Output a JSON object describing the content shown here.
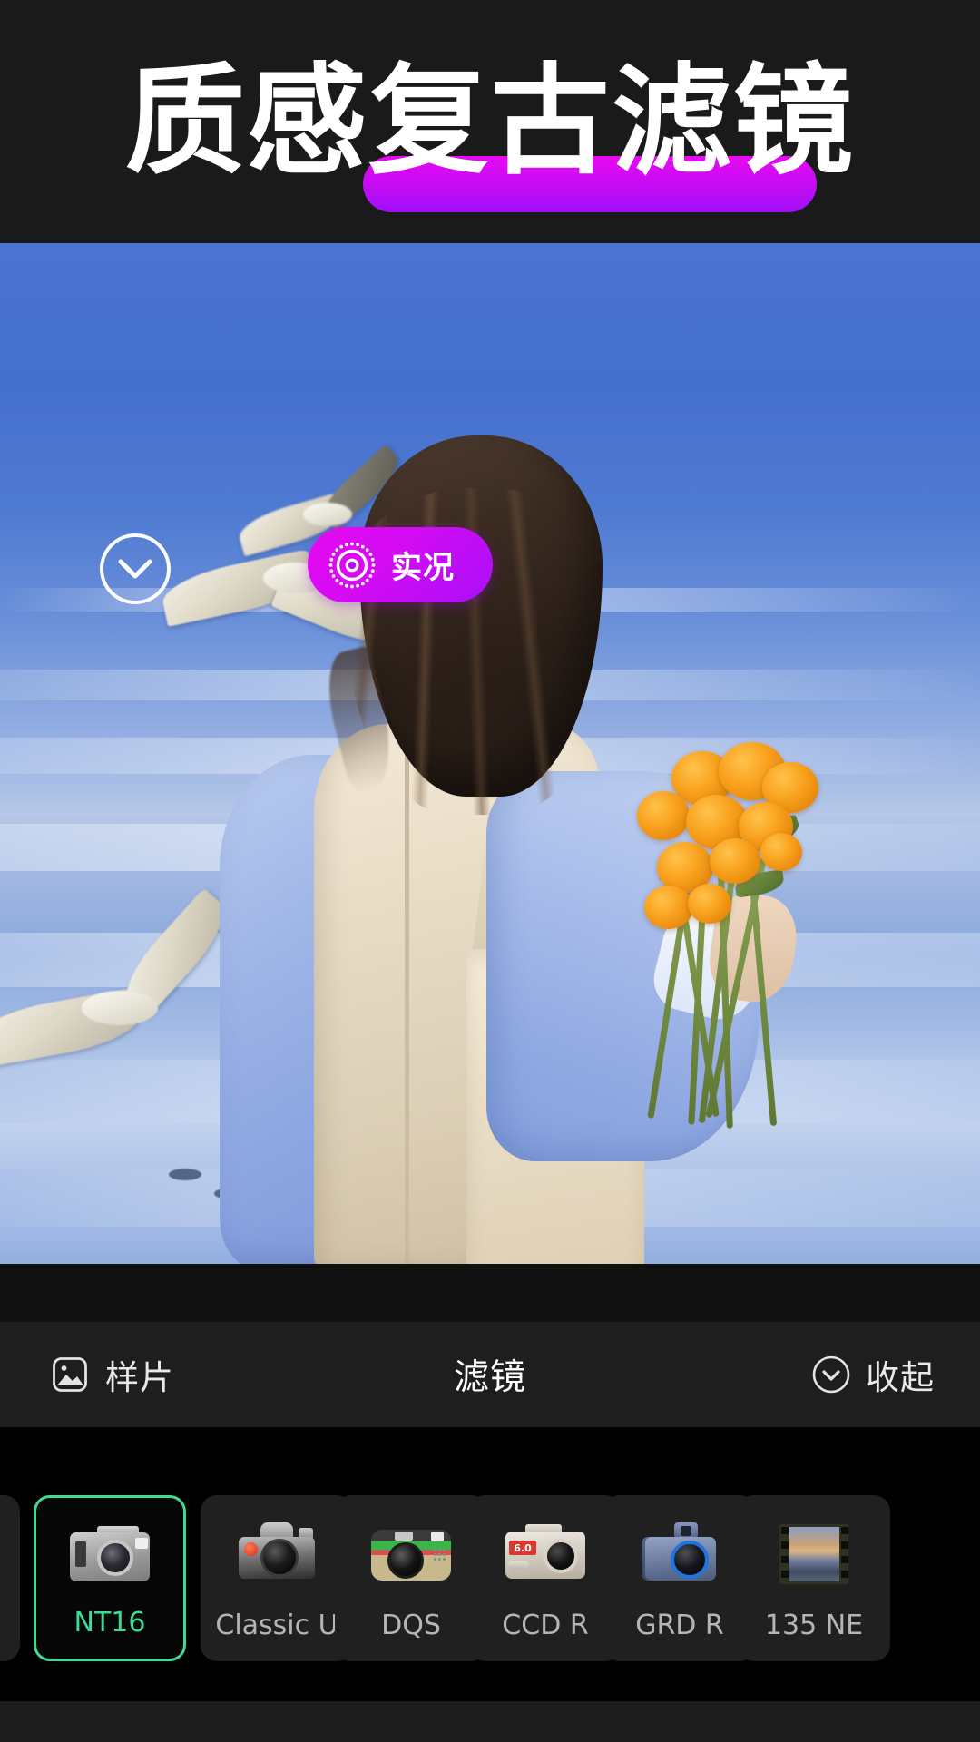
{
  "header": {
    "title": "质感复古滤镜",
    "highlight_color": "#d40bf3",
    "background_color": "#1a1a1a",
    "text_color": "#ffffff"
  },
  "photo_controls": {
    "collapse_circle_icon": "chevron-down-icon",
    "live_button": {
      "label": "实况",
      "icon": "live-photo-icon",
      "gradient_from": "#e609ef",
      "gradient_to": "#a910fa"
    }
  },
  "toolbar": {
    "sample_label": "样片",
    "sample_icon": "image-icon",
    "title": "滤镜",
    "collapse_label": "收起",
    "collapse_icon": "chevron-down-circle-icon",
    "background_color": "#1e1e1e"
  },
  "filters": {
    "selected_index": 1,
    "selected_color": "#3fdb96",
    "items": [
      {
        "label": "",
        "thumb": "camera-partial",
        "selected": false,
        "partial": true
      },
      {
        "label": "NT16",
        "thumb": "camera-compact-grey",
        "selected": true
      },
      {
        "label": "Classic U",
        "thumb": "camera-slr-silver",
        "selected": false
      },
      {
        "label": "DQS",
        "thumb": "camera-disposable-green",
        "selected": false
      },
      {
        "label": "CCD R",
        "thumb": "camera-compact-silver-6.0",
        "selected": false
      },
      {
        "label": "GRD R",
        "thumb": "camera-compact-blue",
        "selected": false
      },
      {
        "label": "135 NE",
        "thumb": "film-strip-sunset",
        "selected": false
      }
    ]
  },
  "photo": {
    "description": "woman-from-behind-with-orange-bouquet-seagulls-over-blue-water",
    "filter_tint": "#4a74cf"
  }
}
